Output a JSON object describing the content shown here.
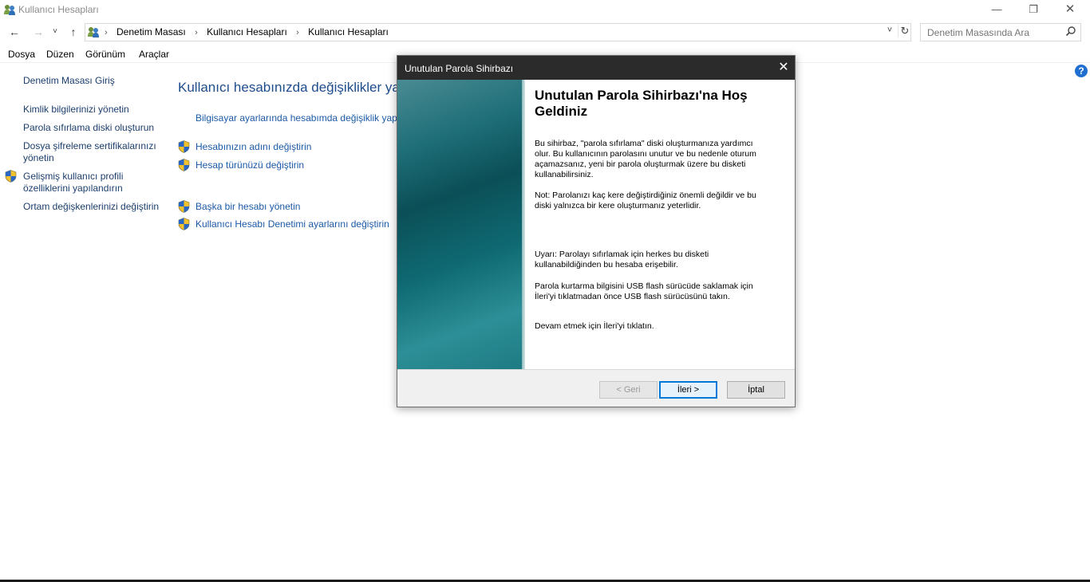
{
  "window": {
    "title": "Kullanıcı Hesapları",
    "minimize_glyph": "—",
    "maximize_glyph": "❐",
    "close_glyph": "✕"
  },
  "nav": {
    "back_glyph": "←",
    "forward_glyph": "→",
    "recent_glyph": "˅",
    "up_glyph": "↑",
    "breadcrumb": [
      "Denetim Masası",
      "Kullanıcı Hesapları",
      "Kullanıcı Hesapları"
    ],
    "separator": "›",
    "dropdown_glyph": "˅",
    "refresh_glyph": "↻",
    "search_placeholder": "Denetim Masasında Ara"
  },
  "menu": [
    "Dosya",
    "Düzen",
    "Görünüm",
    "Araçlar"
  ],
  "help_glyph": "?",
  "sidebar": {
    "items": [
      {
        "label": "Denetim Masası Giriş",
        "shield": false
      },
      {
        "label": "Kimlik bilgilerinizi yönetin",
        "shield": false
      },
      {
        "label": "Parola sıfırlama diski oluşturun",
        "shield": false
      },
      {
        "label": "Dosya şifreleme sertifikalarınızı yönetin",
        "shield": false
      },
      {
        "label": "Gelişmiş kullanıcı profili özelliklerini yapılandırın",
        "shield": true
      },
      {
        "label": "Ortam değişkenlerinizi değiştirin",
        "shield": false
      }
    ]
  },
  "main": {
    "heading": "Kullanıcı hesabınızda değişiklikler yapın",
    "links": [
      {
        "label": "Bilgisayar ayarlarında hesabımda değişiklik yap",
        "shield": false
      },
      {
        "label": "Hesabınızın adını değiştirin",
        "shield": true
      },
      {
        "label": "Hesap türünüzü değiştirin",
        "shield": true
      },
      {
        "label": "Başka bir hesabı yönetin",
        "shield": true
      },
      {
        "label": "Kullanıcı Hesabı Denetimi ayarlarını değiştirin",
        "shield": true
      }
    ]
  },
  "dialog": {
    "title": "Unutulan Parola Sihirbazı",
    "close_glyph": "✕",
    "heading": "Unutulan Parola Sihirbazı'na Hoş Geldiniz",
    "paragraphs": [
      "Bu sihirbaz, \"parola sıfırlama\" diski oluşturmanıza yardımcı olur. Bu kullanıcının parolasını unutur ve bu nedenle oturum açamazsanız, yeni bir parola oluşturmak üzere bu disketi kullanabilirsiniz.",
      "Not: Parolanızı kaç kere değiştirdiğiniz önemli değildir ve bu diski yalnızca bir kere oluşturmanız yeterlidir.",
      "Uyarı: Parolayı sıfırlamak için herkes bu disketi kullanabildiğinden bu hesaba erişebilir.",
      "Parola kurtarma bilgisini USB flash sürücüde saklamak için İleri'yi tıklatmadan önce USB flash sürücüsünü takın.",
      "Devam etmek için İleri'yi tıklatın."
    ],
    "buttons": {
      "back": "< Geri",
      "next": "İleri >",
      "cancel": "İptal"
    }
  }
}
